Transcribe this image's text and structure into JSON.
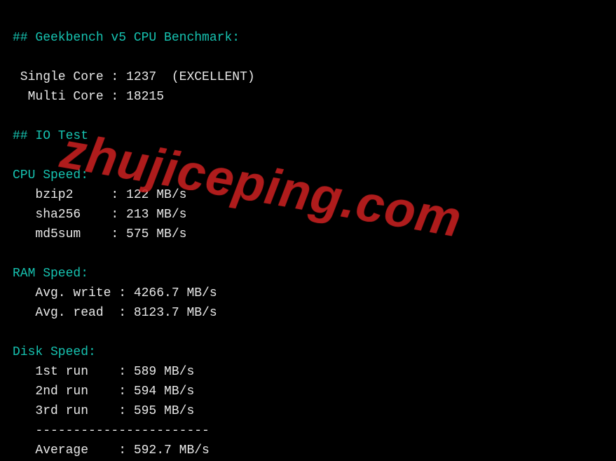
{
  "benchmark": {
    "header": "## Geekbench v5 CPU Benchmark:",
    "single_core": {
      "label": " Single Core",
      "sep": " : ",
      "value": "1237",
      "note": "  (EXCELLENT)"
    },
    "multi_core": {
      "label": "  Multi Core",
      "sep": " : ",
      "value": "18215"
    }
  },
  "iotest": {
    "header": "## IO Test",
    "cpu_speed": {
      "label": "CPU Speed:",
      "bzip2": {
        "label": "   bzip2     : ",
        "value": "122 MB/s"
      },
      "sha256": {
        "label": "   sha256    : ",
        "value": "213 MB/s"
      },
      "md5sum": {
        "label": "   md5sum    : ",
        "value": "575 MB/s"
      }
    },
    "ram_speed": {
      "label": "RAM Speed:",
      "write": {
        "label": "   Avg. write : ",
        "value": "4266.7 MB/s"
      },
      "read": {
        "label": "   Avg. read  : ",
        "value": "8123.7 MB/s"
      }
    },
    "disk_speed": {
      "label": "Disk Speed:",
      "run1": {
        "label": "   1st run    : ",
        "value": "589 MB/s"
      },
      "run2": {
        "label": "   2nd run    : ",
        "value": "594 MB/s"
      },
      "run3": {
        "label": "   3rd run    : ",
        "value": "595 MB/s"
      },
      "divider": "   -----------------------",
      "avg": {
        "label": "   Average    : ",
        "value": "592.7 MB/s"
      }
    }
  },
  "watermark": "zhujiceping.com"
}
